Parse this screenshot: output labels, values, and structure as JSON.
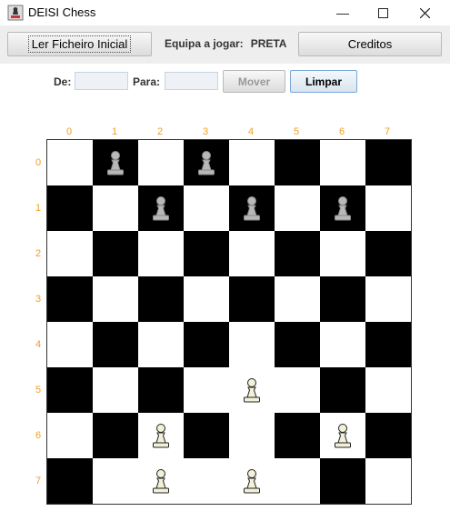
{
  "window": {
    "title": "DEISI Chess"
  },
  "toolbar": {
    "load_label": "Ler Ficheiro Inicial",
    "turn_label": "Equipa a jogar:",
    "turn_value": "PRETA",
    "credits_label": "Creditos"
  },
  "move": {
    "from_label": "De:",
    "from_value": "",
    "to_label": "Para:",
    "to_value": "",
    "move_label": "Mover",
    "clear_label": "Limpar"
  },
  "board": {
    "columns": [
      "0",
      "1",
      "2",
      "3",
      "4",
      "5",
      "6",
      "7"
    ],
    "rows": [
      "0",
      "1",
      "2",
      "3",
      "4",
      "5",
      "6",
      "7"
    ],
    "label_color": "#f0a020",
    "light_color": "#ffffff",
    "dark_color": "#000000",
    "pieces": [
      {
        "row": 0,
        "col": 1,
        "type": "pawn",
        "team": "black",
        "icon": "pawn-icon"
      },
      {
        "row": 0,
        "col": 3,
        "type": "pawn",
        "team": "black",
        "icon": "pawn-icon"
      },
      {
        "row": 1,
        "col": 2,
        "type": "pawn",
        "team": "black",
        "icon": "pawn-icon"
      },
      {
        "row": 1,
        "col": 4,
        "type": "pawn",
        "team": "black",
        "icon": "pawn-icon"
      },
      {
        "row": 1,
        "col": 6,
        "type": "pawn",
        "team": "black",
        "icon": "pawn-icon"
      },
      {
        "row": 5,
        "col": 4,
        "type": "pawn",
        "team": "white",
        "icon": "pawn-icon"
      },
      {
        "row": 6,
        "col": 2,
        "type": "pawn",
        "team": "white",
        "icon": "pawn-icon"
      },
      {
        "row": 6,
        "col": 6,
        "type": "pawn",
        "team": "white",
        "icon": "pawn-icon"
      },
      {
        "row": 7,
        "col": 2,
        "type": "pawn",
        "team": "white",
        "icon": "pawn-icon"
      },
      {
        "row": 7,
        "col": 4,
        "type": "pawn",
        "team": "white",
        "icon": "pawn-icon"
      }
    ]
  }
}
